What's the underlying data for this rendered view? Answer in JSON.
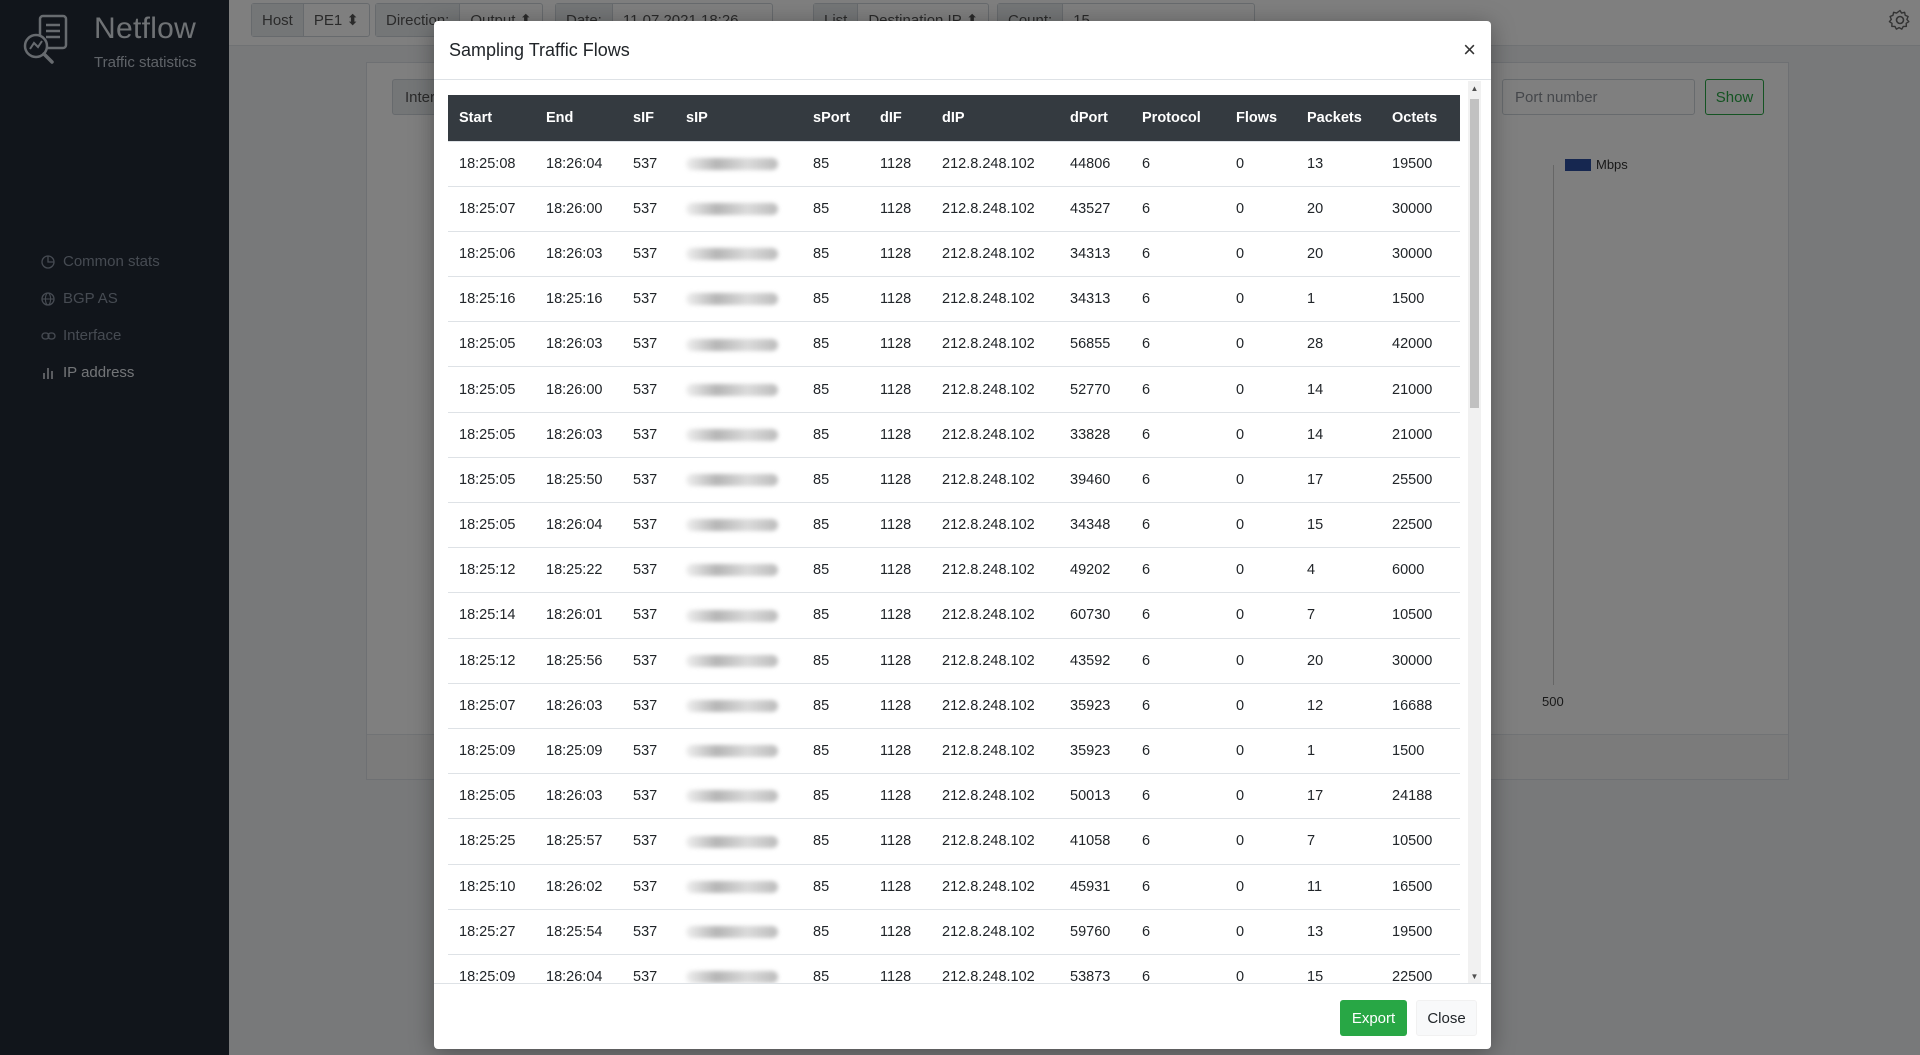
{
  "brand": {
    "title": "Netflow",
    "subtitle": "Traffic statistics"
  },
  "nav": [
    {
      "label": "Common stats",
      "icon": "pie-chart-icon"
    },
    {
      "label": "BGP AS",
      "icon": "globe-icon"
    },
    {
      "label": "Interface",
      "icon": "link-icon"
    },
    {
      "label": "IP address",
      "icon": "bar-chart-icon",
      "active": true
    }
  ],
  "toolbar": {
    "host_label": "Host",
    "host_value": "PE1",
    "direction_label": "Direction:",
    "direction_value": "Output",
    "date_label": "Date:",
    "date_value": "11.07.2021 18:26",
    "list_label": "List",
    "list_value": "Destination IP",
    "count_label": "Count:",
    "count_value": "15"
  },
  "filters": {
    "interface_label": "Inter",
    "port_placeholder": "Port number",
    "show_label": "Show"
  },
  "chart": {
    "legend": "Mbps",
    "tick": "500"
  },
  "modal": {
    "title": "Sampling Traffic Flows",
    "close_symbol": "×",
    "export_label": "Export",
    "close_label": "Close",
    "columns": [
      "Start",
      "End",
      "sIF",
      "sIP",
      "sPort",
      "dIF",
      "dIP",
      "dPort",
      "Protocol",
      "Flows",
      "Packets",
      "Octets"
    ],
    "rows": [
      [
        "18:25:08",
        "18:26:04",
        "537",
        "",
        "85",
        "1128",
        "212.8.248.102",
        "44806",
        "6",
        "0",
        "13",
        "19500"
      ],
      [
        "18:25:07",
        "18:26:00",
        "537",
        "",
        "85",
        "1128",
        "212.8.248.102",
        "43527",
        "6",
        "0",
        "20",
        "30000"
      ],
      [
        "18:25:06",
        "18:26:03",
        "537",
        "",
        "85",
        "1128",
        "212.8.248.102",
        "34313",
        "6",
        "0",
        "20",
        "30000"
      ],
      [
        "18:25:16",
        "18:25:16",
        "537",
        "",
        "85",
        "1128",
        "212.8.248.102",
        "34313",
        "6",
        "0",
        "1",
        "1500"
      ],
      [
        "18:25:05",
        "18:26:03",
        "537",
        "",
        "85",
        "1128",
        "212.8.248.102",
        "56855",
        "6",
        "0",
        "28",
        "42000"
      ],
      [
        "18:25:05",
        "18:26:00",
        "537",
        "",
        "85",
        "1128",
        "212.8.248.102",
        "52770",
        "6",
        "0",
        "14",
        "21000"
      ],
      [
        "18:25:05",
        "18:26:03",
        "537",
        "",
        "85",
        "1128",
        "212.8.248.102",
        "33828",
        "6",
        "0",
        "14",
        "21000"
      ],
      [
        "18:25:05",
        "18:25:50",
        "537",
        "",
        "85",
        "1128",
        "212.8.248.102",
        "39460",
        "6",
        "0",
        "17",
        "25500"
      ],
      [
        "18:25:05",
        "18:26:04",
        "537",
        "",
        "85",
        "1128",
        "212.8.248.102",
        "34348",
        "6",
        "0",
        "15",
        "22500"
      ],
      [
        "18:25:12",
        "18:25:22",
        "537",
        "",
        "85",
        "1128",
        "212.8.248.102",
        "49202",
        "6",
        "0",
        "4",
        "6000"
      ],
      [
        "18:25:14",
        "18:26:01",
        "537",
        "",
        "85",
        "1128",
        "212.8.248.102",
        "60730",
        "6",
        "0",
        "7",
        "10500"
      ],
      [
        "18:25:12",
        "18:25:56",
        "537",
        "",
        "85",
        "1128",
        "212.8.248.102",
        "43592",
        "6",
        "0",
        "20",
        "30000"
      ],
      [
        "18:25:07",
        "18:26:03",
        "537",
        "",
        "85",
        "1128",
        "212.8.248.102",
        "35923",
        "6",
        "0",
        "12",
        "16688"
      ],
      [
        "18:25:09",
        "18:25:09",
        "537",
        "",
        "85",
        "1128",
        "212.8.248.102",
        "35923",
        "6",
        "0",
        "1",
        "1500"
      ],
      [
        "18:25:05",
        "18:26:03",
        "537",
        "",
        "85",
        "1128",
        "212.8.248.102",
        "50013",
        "6",
        "0",
        "17",
        "24188"
      ],
      [
        "18:25:25",
        "18:25:57",
        "537",
        "",
        "85",
        "1128",
        "212.8.248.102",
        "41058",
        "6",
        "0",
        "7",
        "10500"
      ],
      [
        "18:25:10",
        "18:26:02",
        "537",
        "",
        "85",
        "1128",
        "212.8.248.102",
        "45931",
        "6",
        "0",
        "11",
        "16500"
      ],
      [
        "18:25:27",
        "18:25:54",
        "537",
        "",
        "85",
        "1128",
        "212.8.248.102",
        "59760",
        "6",
        "0",
        "13",
        "19500"
      ],
      [
        "18:25:09",
        "18:26:04",
        "537",
        "",
        "85",
        "1128",
        "212.8.248.102",
        "53873",
        "6",
        "0",
        "15",
        "22500"
      ]
    ]
  },
  "colors": {
    "sidebar": "#232a37",
    "table_header": "#343a40",
    "accent_green": "#28a745",
    "legend_blue": "#2c4fa0"
  }
}
